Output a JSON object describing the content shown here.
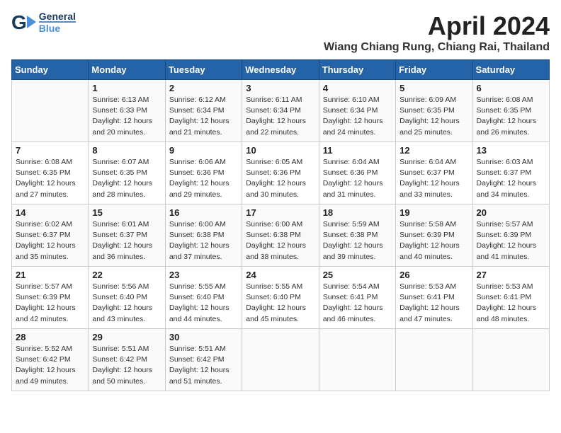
{
  "header": {
    "logo_general": "General",
    "logo_blue": "Blue",
    "month_title": "April 2024",
    "location": "Wiang Chiang Rung, Chiang Rai, Thailand"
  },
  "days_of_week": [
    "Sunday",
    "Monday",
    "Tuesday",
    "Wednesday",
    "Thursday",
    "Friday",
    "Saturday"
  ],
  "weeks": [
    [
      {
        "day": "",
        "lines": []
      },
      {
        "day": "1",
        "lines": [
          "Sunrise: 6:13 AM",
          "Sunset: 6:33 PM",
          "Daylight: 12 hours",
          "and 20 minutes."
        ]
      },
      {
        "day": "2",
        "lines": [
          "Sunrise: 6:12 AM",
          "Sunset: 6:34 PM",
          "Daylight: 12 hours",
          "and 21 minutes."
        ]
      },
      {
        "day": "3",
        "lines": [
          "Sunrise: 6:11 AM",
          "Sunset: 6:34 PM",
          "Daylight: 12 hours",
          "and 22 minutes."
        ]
      },
      {
        "day": "4",
        "lines": [
          "Sunrise: 6:10 AM",
          "Sunset: 6:34 PM",
          "Daylight: 12 hours",
          "and 24 minutes."
        ]
      },
      {
        "day": "5",
        "lines": [
          "Sunrise: 6:09 AM",
          "Sunset: 6:35 PM",
          "Daylight: 12 hours",
          "and 25 minutes."
        ]
      },
      {
        "day": "6",
        "lines": [
          "Sunrise: 6:08 AM",
          "Sunset: 6:35 PM",
          "Daylight: 12 hours",
          "and 26 minutes."
        ]
      }
    ],
    [
      {
        "day": "7",
        "lines": [
          "Sunrise: 6:08 AM",
          "Sunset: 6:35 PM",
          "Daylight: 12 hours",
          "and 27 minutes."
        ]
      },
      {
        "day": "8",
        "lines": [
          "Sunrise: 6:07 AM",
          "Sunset: 6:35 PM",
          "Daylight: 12 hours",
          "and 28 minutes."
        ]
      },
      {
        "day": "9",
        "lines": [
          "Sunrise: 6:06 AM",
          "Sunset: 6:36 PM",
          "Daylight: 12 hours",
          "and 29 minutes."
        ]
      },
      {
        "day": "10",
        "lines": [
          "Sunrise: 6:05 AM",
          "Sunset: 6:36 PM",
          "Daylight: 12 hours",
          "and 30 minutes."
        ]
      },
      {
        "day": "11",
        "lines": [
          "Sunrise: 6:04 AM",
          "Sunset: 6:36 PM",
          "Daylight: 12 hours",
          "and 31 minutes."
        ]
      },
      {
        "day": "12",
        "lines": [
          "Sunrise: 6:04 AM",
          "Sunset: 6:37 PM",
          "Daylight: 12 hours",
          "and 33 minutes."
        ]
      },
      {
        "day": "13",
        "lines": [
          "Sunrise: 6:03 AM",
          "Sunset: 6:37 PM",
          "Daylight: 12 hours",
          "and 34 minutes."
        ]
      }
    ],
    [
      {
        "day": "14",
        "lines": [
          "Sunrise: 6:02 AM",
          "Sunset: 6:37 PM",
          "Daylight: 12 hours",
          "and 35 minutes."
        ]
      },
      {
        "day": "15",
        "lines": [
          "Sunrise: 6:01 AM",
          "Sunset: 6:37 PM",
          "Daylight: 12 hours",
          "and 36 minutes."
        ]
      },
      {
        "day": "16",
        "lines": [
          "Sunrise: 6:00 AM",
          "Sunset: 6:38 PM",
          "Daylight: 12 hours",
          "and 37 minutes."
        ]
      },
      {
        "day": "17",
        "lines": [
          "Sunrise: 6:00 AM",
          "Sunset: 6:38 PM",
          "Daylight: 12 hours",
          "and 38 minutes."
        ]
      },
      {
        "day": "18",
        "lines": [
          "Sunrise: 5:59 AM",
          "Sunset: 6:38 PM",
          "Daylight: 12 hours",
          "and 39 minutes."
        ]
      },
      {
        "day": "19",
        "lines": [
          "Sunrise: 5:58 AM",
          "Sunset: 6:39 PM",
          "Daylight: 12 hours",
          "and 40 minutes."
        ]
      },
      {
        "day": "20",
        "lines": [
          "Sunrise: 5:57 AM",
          "Sunset: 6:39 PM",
          "Daylight: 12 hours",
          "and 41 minutes."
        ]
      }
    ],
    [
      {
        "day": "21",
        "lines": [
          "Sunrise: 5:57 AM",
          "Sunset: 6:39 PM",
          "Daylight: 12 hours",
          "and 42 minutes."
        ]
      },
      {
        "day": "22",
        "lines": [
          "Sunrise: 5:56 AM",
          "Sunset: 6:40 PM",
          "Daylight: 12 hours",
          "and 43 minutes."
        ]
      },
      {
        "day": "23",
        "lines": [
          "Sunrise: 5:55 AM",
          "Sunset: 6:40 PM",
          "Daylight: 12 hours",
          "and 44 minutes."
        ]
      },
      {
        "day": "24",
        "lines": [
          "Sunrise: 5:55 AM",
          "Sunset: 6:40 PM",
          "Daylight: 12 hours",
          "and 45 minutes."
        ]
      },
      {
        "day": "25",
        "lines": [
          "Sunrise: 5:54 AM",
          "Sunset: 6:41 PM",
          "Daylight: 12 hours",
          "and 46 minutes."
        ]
      },
      {
        "day": "26",
        "lines": [
          "Sunrise: 5:53 AM",
          "Sunset: 6:41 PM",
          "Daylight: 12 hours",
          "and 47 minutes."
        ]
      },
      {
        "day": "27",
        "lines": [
          "Sunrise: 5:53 AM",
          "Sunset: 6:41 PM",
          "Daylight: 12 hours",
          "and 48 minutes."
        ]
      }
    ],
    [
      {
        "day": "28",
        "lines": [
          "Sunrise: 5:52 AM",
          "Sunset: 6:42 PM",
          "Daylight: 12 hours",
          "and 49 minutes."
        ]
      },
      {
        "day": "29",
        "lines": [
          "Sunrise: 5:51 AM",
          "Sunset: 6:42 PM",
          "Daylight: 12 hours",
          "and 50 minutes."
        ]
      },
      {
        "day": "30",
        "lines": [
          "Sunrise: 5:51 AM",
          "Sunset: 6:42 PM",
          "Daylight: 12 hours",
          "and 51 minutes."
        ]
      },
      {
        "day": "",
        "lines": []
      },
      {
        "day": "",
        "lines": []
      },
      {
        "day": "",
        "lines": []
      },
      {
        "day": "",
        "lines": []
      }
    ]
  ]
}
